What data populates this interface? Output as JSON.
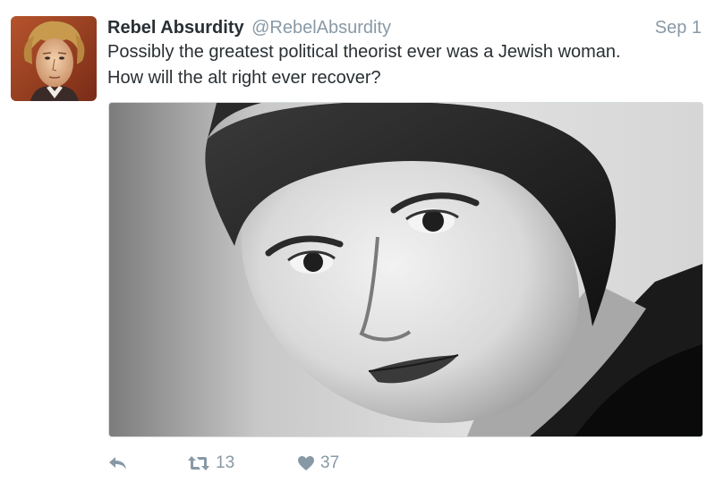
{
  "tweet": {
    "display_name": "Rebel Absurdity",
    "handle": "@RebelAbsurdity",
    "timestamp": "Sep 1",
    "text": "Possibly the greatest political theorist ever was a Jewish woman.\nHow will the alt right ever recover?",
    "avatar_icon": "portrait-avatar",
    "media_icon": "black-and-white-portrait-photo",
    "actions": {
      "reply_icon": "reply-icon",
      "retweet_icon": "retweet-icon",
      "retweet_count": "13",
      "like_icon": "heart-icon",
      "like_count": "37"
    },
    "colors": {
      "text": "#292f33",
      "muted": "#8899a6"
    }
  }
}
